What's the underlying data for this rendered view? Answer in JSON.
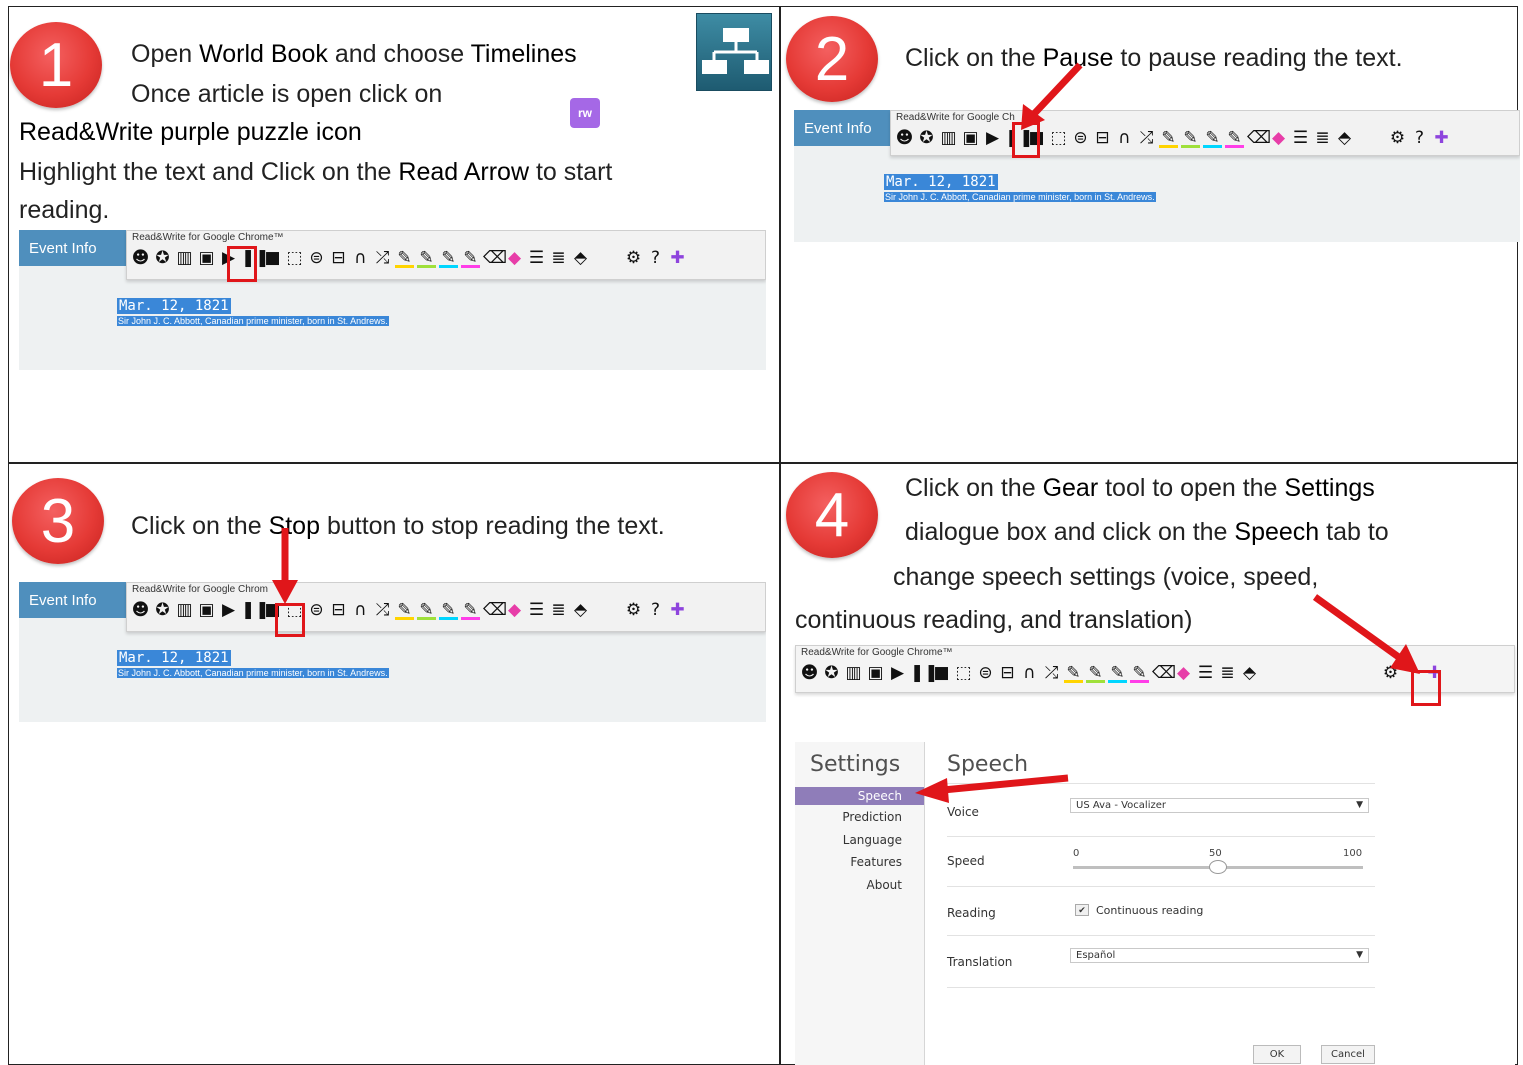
{
  "steps": [
    {
      "number": "1"
    },
    {
      "number": "2"
    },
    {
      "number": "3"
    },
    {
      "number": "4"
    }
  ],
  "step1": {
    "l1_a": "Open ",
    "l1_b": "World Book",
    "l1_c": " and choose ",
    "l1_d": "Timelines",
    "l2": "Once article is open click on",
    "l3": "Read&Write purple puzzle icon",
    "l4_a": "Highlight the text and Click on the ",
    "l4_b": "Read Arrow",
    "l4_c": " to start",
    "l5": "reading."
  },
  "step2": {
    "a": "Click on the ",
    "b": "Pause",
    "c": " to pause reading the text."
  },
  "step3": {
    "a": "Click on the ",
    "b": "Stop",
    "c": " button to stop reading the text."
  },
  "step4": {
    "l1_a": "Click on the ",
    "l1_b": "Gear",
    "l1_c": " tool to open the ",
    "l1_d": "Settings",
    "l2_a": "dialogue box and click on the ",
    "l2_b": "Speech",
    "l2_c": " tab to",
    "l3": "change speech settings (voice, speed,",
    "l4": "continuous reading, and translation)"
  },
  "screenshot": {
    "tab": "Event Info",
    "toolbar_title": "Read&Write for Google Chrome™",
    "toolbar_title_cut2": "Read&Write for Google Ch",
    "toolbar_title_cut3": "Read&Write for Google Chrom",
    "date": "Mar. 12, 1821",
    "event": "Sir John J. C. Abbott, Canadian prime minister, born in St. Andrews."
  },
  "toolbar_icons": [
    "talking-head-icon",
    "predict-icon",
    "dictionary-icon",
    "picture-dictionary-icon",
    "play-icon",
    "pause-icon",
    "stop-icon",
    "screenshot-reader-icon",
    "audio-maker-icon",
    "speech-input-icon",
    "listen-icon",
    "translator-icon",
    "highlight-yellow-icon",
    "highlight-green-icon",
    "highlight-blue-icon",
    "highlight-pink-icon",
    "clear-highlights-icon",
    "collect-highlights-icon",
    "vocabulary-icon",
    "web-search-icon",
    "simplify-icon",
    "settings-gear-icon",
    "help-icon",
    "rw-puzzle-icon"
  ],
  "rw_logo": "rw",
  "settings": {
    "sidebar_title": "Settings",
    "nav": [
      "Speech",
      "Prediction",
      "Language",
      "Features",
      "About"
    ],
    "panel_title": "Speech",
    "voice_label": "Voice",
    "voice_value": "US Ava - Vocalizer",
    "speed_label": "Speed",
    "speed_ticks": [
      "0",
      "50",
      "100"
    ],
    "speed_value": 50,
    "reading_label": "Reading",
    "continuous_label": "Continuous reading",
    "continuous_checked": true,
    "translation_label": "Translation",
    "translation_value": "Español",
    "ok": "OK",
    "cancel": "Cancel"
  }
}
